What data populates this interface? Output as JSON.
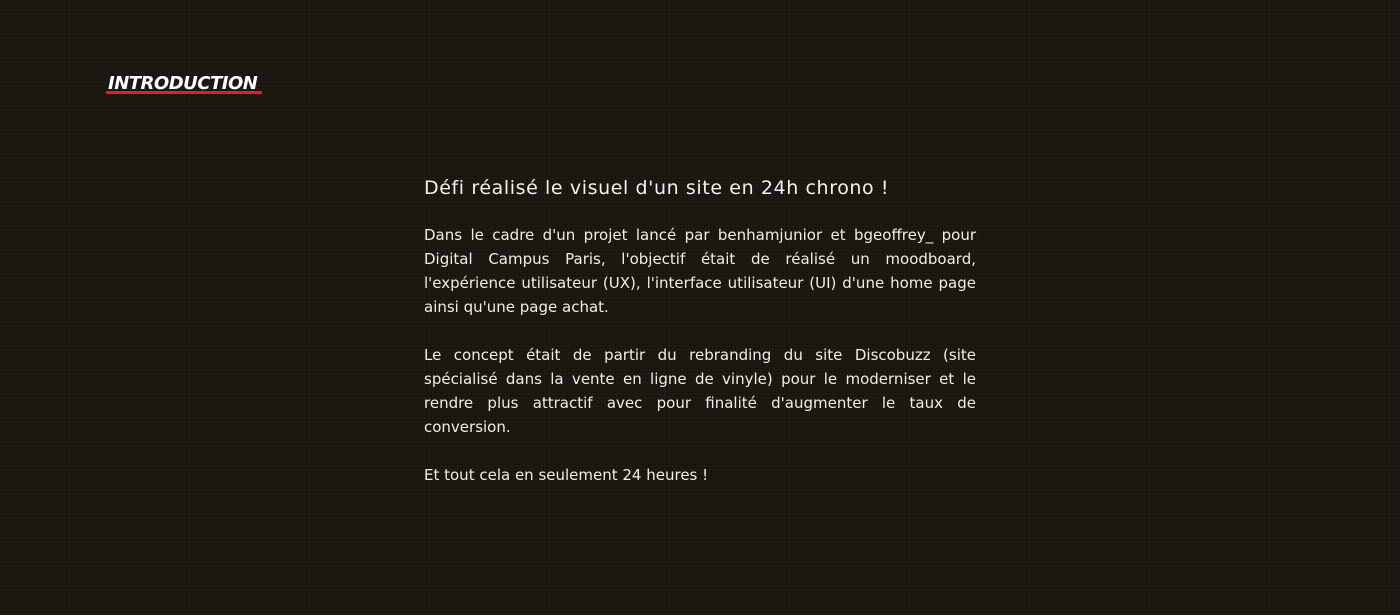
{
  "section": {
    "title": "INTRODUCTION",
    "accent_color": "#d62331"
  },
  "content": {
    "heading": "Défi réalisé le visuel d'un site en 24h chrono !",
    "paragraphs": [
      "Dans le cadre d'un projet lancé par benhamjunior et bgeoffrey_ pour Digital Campus Paris, l'objectif était de réalisé un moodboard, l'expérience utilisateur (UX), l'interface utilisateur (UI) d'une home page ainsi qu'une page achat.",
      "Le concept était de partir du rebranding du site Discobuzz (site spécialisé dans la vente en ligne de vinyle) pour le moderniser et le rendre plus attractif avec pour finalité d'augmenter le taux de conversion.",
      "Et tout cela en seulement 24 heures !"
    ]
  }
}
